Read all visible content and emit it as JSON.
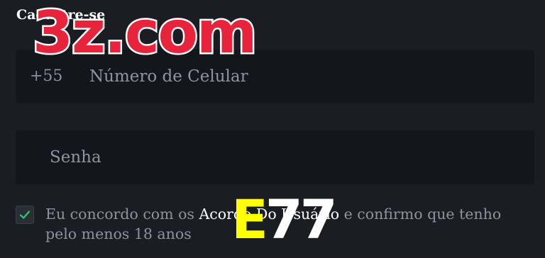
{
  "page": {
    "title": "Cadastre-se"
  },
  "form": {
    "phone": {
      "prefix": "+55",
      "placeholder": "Número de Celular",
      "value": ""
    },
    "password": {
      "placeholder": "Senha",
      "value": ""
    },
    "agreement": {
      "checked": true,
      "text_before": "Eu concordo com os ",
      "link_label": "Acordo Do Usuário",
      "text_after": " e confirmo que tenho pelo menos 18 anos"
    }
  },
  "overlays": {
    "logo_text": "3z.com",
    "badge_e": "E",
    "badge_num": "77"
  },
  "colors": {
    "background": "#1a1e23",
    "field_background": "#13171b",
    "check_accent": "#2ecc71",
    "logo_red": "#e8243c",
    "badge_yellow": "#ffff00"
  }
}
